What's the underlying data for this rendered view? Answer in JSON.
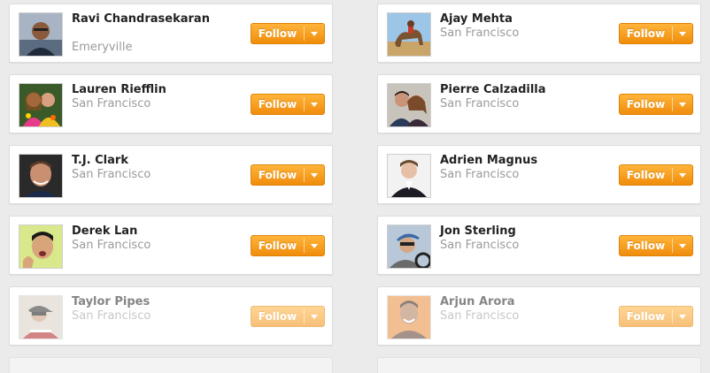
{
  "follow_label": "Follow",
  "colors": {
    "accent": "#f7a01f",
    "accent_dark": "#e08206",
    "name": "#222222",
    "location": "#9a9a9a"
  },
  "people": [
    {
      "name": "Ravi Chandrasekaran",
      "location": "Emeryville",
      "avatar_icon": "person-avatar-icon"
    },
    {
      "name": "Ajay Mehta",
      "location": "San Francisco",
      "avatar_icon": "person-with-camel-avatar-icon"
    },
    {
      "name": "Lauren Riefflin",
      "location": "San Francisco",
      "avatar_icon": "two-people-avatar-icon"
    },
    {
      "name": "Pierre Calzadilla",
      "location": "San Francisco",
      "avatar_icon": "couple-avatar-icon"
    },
    {
      "name": "T.J. Clark",
      "location": "San Francisco",
      "avatar_icon": "person-avatar-icon"
    },
    {
      "name": "Adrien Magnus",
      "location": "San Francisco",
      "avatar_icon": "person-in-suit-avatar-icon"
    },
    {
      "name": "Derek Lan",
      "location": "San Francisco",
      "avatar_icon": "person-avatar-icon"
    },
    {
      "name": "Jon Sterling",
      "location": "San Francisco",
      "avatar_icon": "person-in-car-avatar-icon"
    },
    {
      "name": "Taylor Pipes",
      "location": "San Francisco",
      "avatar_icon": "person-in-cap-avatar-icon"
    },
    {
      "name": "Arjun Arora",
      "location": "San Francisco",
      "avatar_icon": "person-avatar-icon"
    }
  ]
}
